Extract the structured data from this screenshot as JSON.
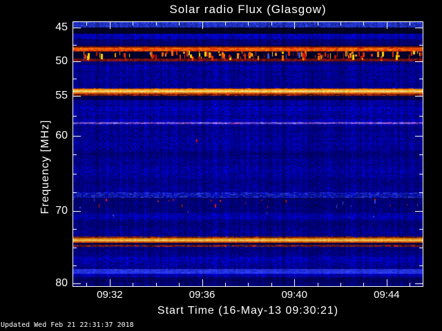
{
  "page": {
    "title": "Solar radio Flux (Glasgow)",
    "footer": "Updated Wed Feb 21 22:31:37 2018",
    "background_color": "#000000",
    "axis_color": "#ffffff"
  },
  "chart_data": {
    "type": "heatmap",
    "title": "Solar radio Flux (Glasgow)",
    "xlabel": "Start Time (16-May-13 09:30:21)",
    "ylabel": "Frequency [MHz]",
    "start_time": "09:30:21",
    "date": "16-May-13",
    "station": "Glasgow",
    "x_axis": {
      "labels": [
        "09:32",
        "09:36",
        "09:40",
        "09:44"
      ],
      "major_minutes": [
        2,
        6,
        10,
        14
      ],
      "minor_minutes": [
        1,
        3,
        4,
        5,
        7,
        8,
        9,
        11,
        12,
        13,
        15
      ]
    },
    "y_tick_labels": [
      45,
      50,
      55,
      60,
      70,
      80
    ],
    "y_minor_ticks": [
      47.5,
      52.5,
      57.5,
      62.5,
      65,
      67.5,
      72.5,
      75,
      77.5
    ],
    "freq_range_mhz": [
      44.1,
      80.3
    ],
    "freq_anchors": [
      [
        45,
        8
      ],
      [
        50,
        57
      ],
      [
        55,
        107
      ],
      [
        60,
        165
      ],
      [
        70,
        274
      ],
      [
        80,
        379
      ]
    ],
    "background_color": "#000098",
    "bands": [
      {
        "f0": 44.0,
        "f1": 50.0,
        "c": "#000096"
      },
      {
        "f0": 50.0,
        "f1": 56.0,
        "c": "#00009e"
      },
      {
        "f0": 56.0,
        "f1": 68.0,
        "c": "#000094"
      },
      {
        "f0": 68.0,
        "f1": 74.0,
        "c": "#00008c"
      },
      {
        "f0": 74.0,
        "f1": 80.4,
        "c": "#000094"
      },
      {
        "f0": 44.05,
        "f1": 44.95,
        "c": "#2133cb"
      },
      {
        "f0": 44.95,
        "f1": 45.95,
        "c": "#00002a"
      },
      {
        "f0": 45.95,
        "f1": 46.75,
        "c": "#0000b2"
      },
      {
        "f0": 46.75,
        "f1": 47.55,
        "c": "#000082"
      },
      {
        "f0": 47.55,
        "f1": 47.8,
        "c": "#000052"
      },
      {
        "f0": 47.8,
        "f1": 47.95,
        "c": "#6e1205",
        "na": 0.3
      },
      {
        "f0": 47.95,
        "f1": 48.42,
        "c": "#f85a00",
        "sp": [
          "#ff8a00",
          "#e83800",
          "#ff6c00",
          "#d42600"
        ],
        "spp": 0.55,
        "na": 0.12,
        "cp": 0.3
      },
      {
        "f0": 48.42,
        "f1": 48.58,
        "c": "#88180a",
        "na": 0.3
      },
      {
        "f0": 48.58,
        "f1": 48.72,
        "c": "#000038"
      },
      {
        "f0": 48.72,
        "f1": 49.62,
        "c": "#000030"
      },
      {
        "f0": 49.62,
        "f1": 50.02,
        "c": "#701414",
        "sp": [
          "#a01818",
          "#58100e",
          "#8c1410"
        ],
        "spp": 0.5,
        "na": 0.25
      },
      {
        "f0": 50.02,
        "f1": 50.45,
        "c": "#000078"
      },
      {
        "f0": 50.75,
        "f1": 51.3,
        "c": "#0000b6"
      },
      {
        "f0": 52.0,
        "f1": 52.7,
        "c": "#00008c"
      },
      {
        "f0": 53.85,
        "f1": 54.05,
        "c": "#93220a",
        "sp": [
          "#c84a00",
          "#7c1a06",
          "#e06000",
          "#304090"
        ],
        "spp": 0.6,
        "na": 0.25
      },
      {
        "f0": 54.05,
        "f1": 54.2,
        "c": "#ff9000",
        "na": 0.15,
        "cp": 0.3
      },
      {
        "f0": 54.2,
        "f1": 54.5,
        "c": "#ffdf7e",
        "sp": [
          "#ffd45e",
          "#ffeb9e",
          "#ffc83e"
        ],
        "spp": 0.5,
        "na": 0.08,
        "cp": 0.2
      },
      {
        "f0": 54.5,
        "f1": 54.68,
        "c": "#f06800",
        "na": 0.18,
        "cp": 0.3
      },
      {
        "f0": 54.68,
        "f1": 54.98,
        "c": "#701808",
        "sp": [
          "#9c2410",
          "#4a1408",
          "#b03010"
        ],
        "spp": 0.55,
        "na": 0.3
      },
      {
        "f0": 54.98,
        "f1": 55.5,
        "c": "#000058"
      },
      {
        "f0": 56.4,
        "f1": 57.45,
        "c": "#0000bc"
      },
      {
        "f0": 57.9,
        "f1": 58.3,
        "c": "#0000b0"
      },
      {
        "f0": 58.3,
        "f1": 58.55,
        "c": "#5a44d8",
        "sp": [
          "#7a66e8",
          "#4434b8",
          "#8877ff",
          "#b04ad0"
        ],
        "spp": 0.6,
        "na": 0.25
      },
      {
        "f0": 58.55,
        "f1": 58.9,
        "c": "#0000ae"
      },
      {
        "f0": 60.3,
        "f1": 61.2,
        "c": "#0000b0"
      },
      {
        "f0": 62.2,
        "f1": 63.1,
        "c": "#000088"
      },
      {
        "f0": 64.0,
        "f1": 64.9,
        "c": "#0000ac"
      },
      {
        "f0": 66.3,
        "f1": 67.1,
        "c": "#000090"
      },
      {
        "f0": 67.55,
        "f1": 68.25,
        "c": "#0a14c6",
        "sp": [
          "#2030d8",
          "#0008a8",
          "#3042e0"
        ],
        "spp": 0.5,
        "na": 0.35
      },
      {
        "f0": 68.25,
        "f1": 69.55,
        "c": "#000074"
      },
      {
        "f0": 70.3,
        "f1": 71.1,
        "c": "#0000a8"
      },
      {
        "f0": 73.5,
        "f1": 73.68,
        "c": "#7c1c0c",
        "sp": [
          "#a82a10",
          "#541208",
          "#c03a10",
          "#202890"
        ],
        "spp": 0.55,
        "na": 0.3
      },
      {
        "f0": 73.68,
        "f1": 73.9,
        "c": "#ff8800",
        "na": 0.15,
        "cp": 0.3
      },
      {
        "f0": 73.9,
        "f1": 74.22,
        "c": "#ffd662",
        "sp": [
          "#ffc845",
          "#ffe284",
          "#ffba30"
        ],
        "spp": 0.5,
        "na": 0.08,
        "cp": 0.2
      },
      {
        "f0": 74.22,
        "f1": 74.4,
        "c": "#ee5500",
        "na": 0.18,
        "cp": 0.3
      },
      {
        "f0": 74.4,
        "f1": 74.62,
        "c": "#000048"
      },
      {
        "f0": 74.62,
        "f1": 74.95,
        "c": "#681414",
        "sp": [
          "#8c1a10",
          "#3c0e0a",
          "#a42414",
          "#101c70"
        ],
        "spp": 0.6,
        "na": 0.3
      },
      {
        "f0": 74.95,
        "f1": 75.4,
        "c": "#000080"
      },
      {
        "f0": 76.4,
        "f1": 77.7,
        "c": "#0000ae",
        "sp": [
          "#0000c4",
          "#000092"
        ],
        "spp": 0.45,
        "na": 0.4
      },
      {
        "f0": 78.0,
        "f1": 78.62,
        "c": "#2434ec",
        "sp": [
          "#3240f4",
          "#1a28d8"
        ],
        "spp": 0.4,
        "na": 0.18,
        "cp": 0.4
      },
      {
        "f0": 78.62,
        "f1": 79.1,
        "c": "#0000ac"
      },
      {
        "f0": 79.1,
        "f1": 80.4,
        "c": "#000072"
      }
    ],
    "blip_rows": [
      {
        "f0": 48.5,
        "f1": 49.66,
        "count": 140,
        "wmin": 1,
        "wmax": 3,
        "hmin": 3,
        "hmax": 9,
        "palette": [
          "#ffd400",
          "#ff9400",
          "#e63200",
          "#c01400",
          "#ff6a00",
          "#4050d8"
        ],
        "weights": [
          0.2,
          0.18,
          0.26,
          0.2,
          0.1,
          0.06
        ]
      },
      {
        "f0": 68.35,
        "f1": 69.5,
        "count": 24,
        "wmin": 1,
        "wmax": 2,
        "hmin": 2,
        "hmax": 6,
        "palette": [
          "#d41a1a",
          "#a81212",
          "#3b4bd4"
        ],
        "weights": [
          0.45,
          0.35,
          0.2
        ]
      },
      {
        "f0": 70.0,
        "f1": 70.7,
        "count": 6,
        "wmin": 1,
        "wmax": 2,
        "hmin": 2,
        "hmax": 4,
        "palette": [
          "#3b4bd4",
          "#5a3cd8"
        ],
        "weights": [
          0.6,
          0.4
        ]
      }
    ],
    "extra_dots": [
      {
        "xf": 0.352,
        "f": 60.45,
        "w": 2,
        "h": 4,
        "c": "#cc2200"
      }
    ],
    "vertical_highlight": {
      "xf": 0.405,
      "gain": 1.18,
      "halfwidth": 3
    }
  }
}
